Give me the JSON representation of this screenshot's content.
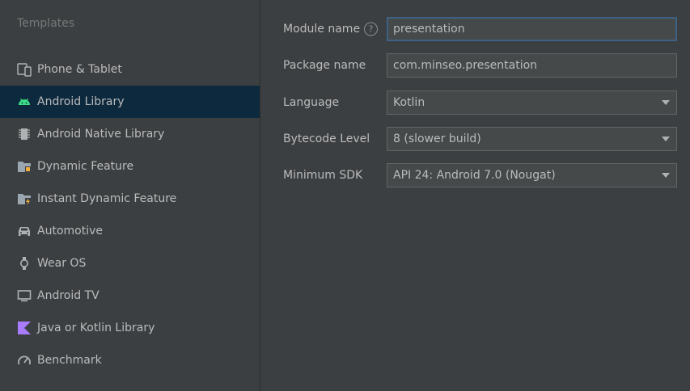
{
  "sidebar": {
    "title": "Templates",
    "items": [
      {
        "label": "Phone & Tablet",
        "icon": "phone-tablet-icon"
      },
      {
        "label": "Android Library",
        "icon": "android-icon",
        "selected": true
      },
      {
        "label": "Android Native Library",
        "icon": "chip-icon"
      },
      {
        "label": "Dynamic Feature",
        "icon": "folder-feature-icon"
      },
      {
        "label": "Instant Dynamic Feature",
        "icon": "folder-instant-icon"
      },
      {
        "label": "Automotive",
        "icon": "car-icon"
      },
      {
        "label": "Wear OS",
        "icon": "watch-icon"
      },
      {
        "label": "Android TV",
        "icon": "tv-icon"
      },
      {
        "label": "Java or Kotlin Library",
        "icon": "kotlin-icon"
      },
      {
        "label": "Benchmark",
        "icon": "gauge-icon"
      }
    ]
  },
  "form": {
    "module_name": {
      "label": "Module name",
      "value": "presentation"
    },
    "package_name": {
      "label": "Package name",
      "value": "com.minseo.presentation"
    },
    "language": {
      "label": "Language",
      "value": "Kotlin"
    },
    "bytecode_level": {
      "label": "Bytecode Level",
      "value": "8 (slower build)"
    },
    "minimum_sdk": {
      "label": "Minimum SDK",
      "value": "API 24: Android 7.0 (Nougat)"
    }
  },
  "colors": {
    "background": "#3c3f41",
    "selection": "#0d293e",
    "accent_focus": "#3d6185",
    "android_green": "#3ddc84",
    "kotlin_purple": "#a97bff"
  }
}
